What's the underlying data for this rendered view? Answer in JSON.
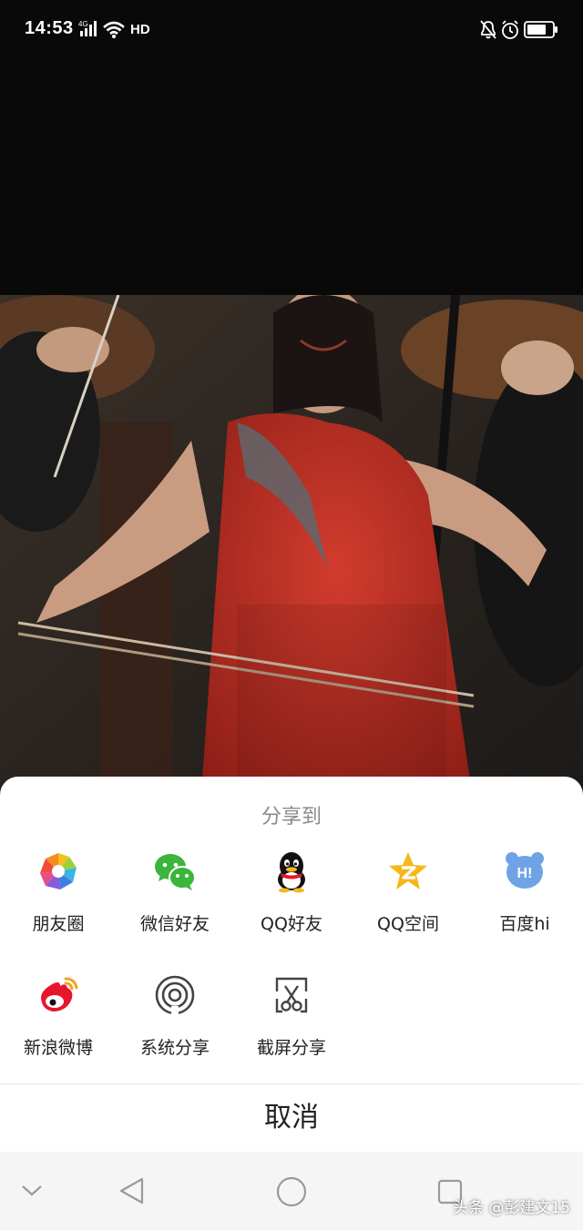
{
  "status_bar": {
    "time": "14:53",
    "network": "4G",
    "hd": "HD"
  },
  "share_sheet": {
    "title": "分享到",
    "row1": [
      {
        "label": "朋友圈",
        "icon": "moments-icon"
      },
      {
        "label": "微信好友",
        "icon": "wechat-icon"
      },
      {
        "label": "QQ好友",
        "icon": "qq-icon"
      },
      {
        "label": "QQ空间",
        "icon": "qzone-icon"
      },
      {
        "label": "百度hi",
        "icon": "baidu-hi-icon"
      }
    ],
    "row2": [
      {
        "label": "新浪微博",
        "icon": "weibo-icon"
      },
      {
        "label": "系统分享",
        "icon": "system-share-icon"
      },
      {
        "label": "截屏分享",
        "icon": "screenshot-share-icon"
      }
    ],
    "baidu_badge": "H!",
    "cancel": "取消"
  },
  "watermark": "头条 @彭建文15",
  "colors": {
    "sheet_bg": "#ffffff",
    "title": "#8a8a8a",
    "accent_wechat": "#3bb53c",
    "accent_qzone": "#f5b81c",
    "accent_weibo": "#e6162d",
    "accent_baidu": "#6fa3e6"
  }
}
